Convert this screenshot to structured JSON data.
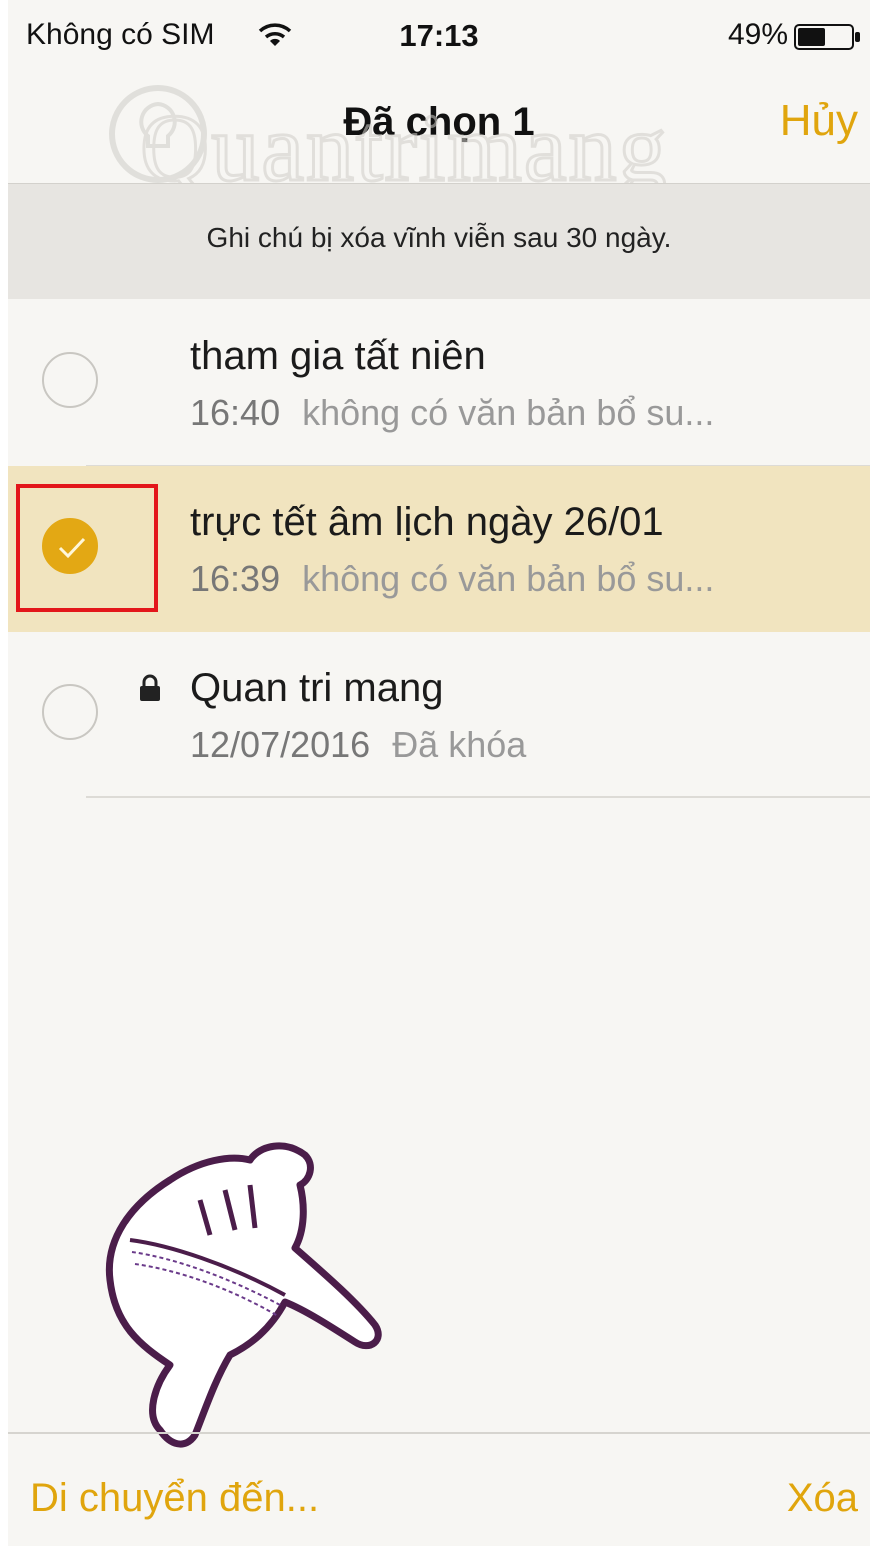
{
  "status_bar": {
    "carrier": "Không có SIM",
    "time": "17:13",
    "battery": "49%"
  },
  "nav": {
    "title": "Đã chọn 1",
    "cancel": "Hủy"
  },
  "banner": {
    "text": "Ghi chú bị xóa vĩnh viễn sau 30 ngày."
  },
  "notes": [
    {
      "title": "tham gia tất niên",
      "time": "16:40",
      "preview": "không có văn bản bổ su...",
      "selected": false,
      "locked": false
    },
    {
      "title": "trực tết âm lịch ngày 26/01",
      "time": "16:39",
      "preview": "không có văn bản bổ su...",
      "selected": true,
      "locked": false
    },
    {
      "title": "Quan tri mang",
      "time": "12/07/2016",
      "preview": "Đã khóa",
      "selected": false,
      "locked": true
    }
  ],
  "toolbar": {
    "move": "Di chuyển đến...",
    "delete": "Xóa"
  },
  "watermark": {
    "text": "Quantrimang"
  },
  "colors": {
    "accent": "#e0a50d",
    "selected_row": "#f1e4bf",
    "highlight_box": "#e3161b",
    "hand_outline": "#4b1d4a"
  }
}
